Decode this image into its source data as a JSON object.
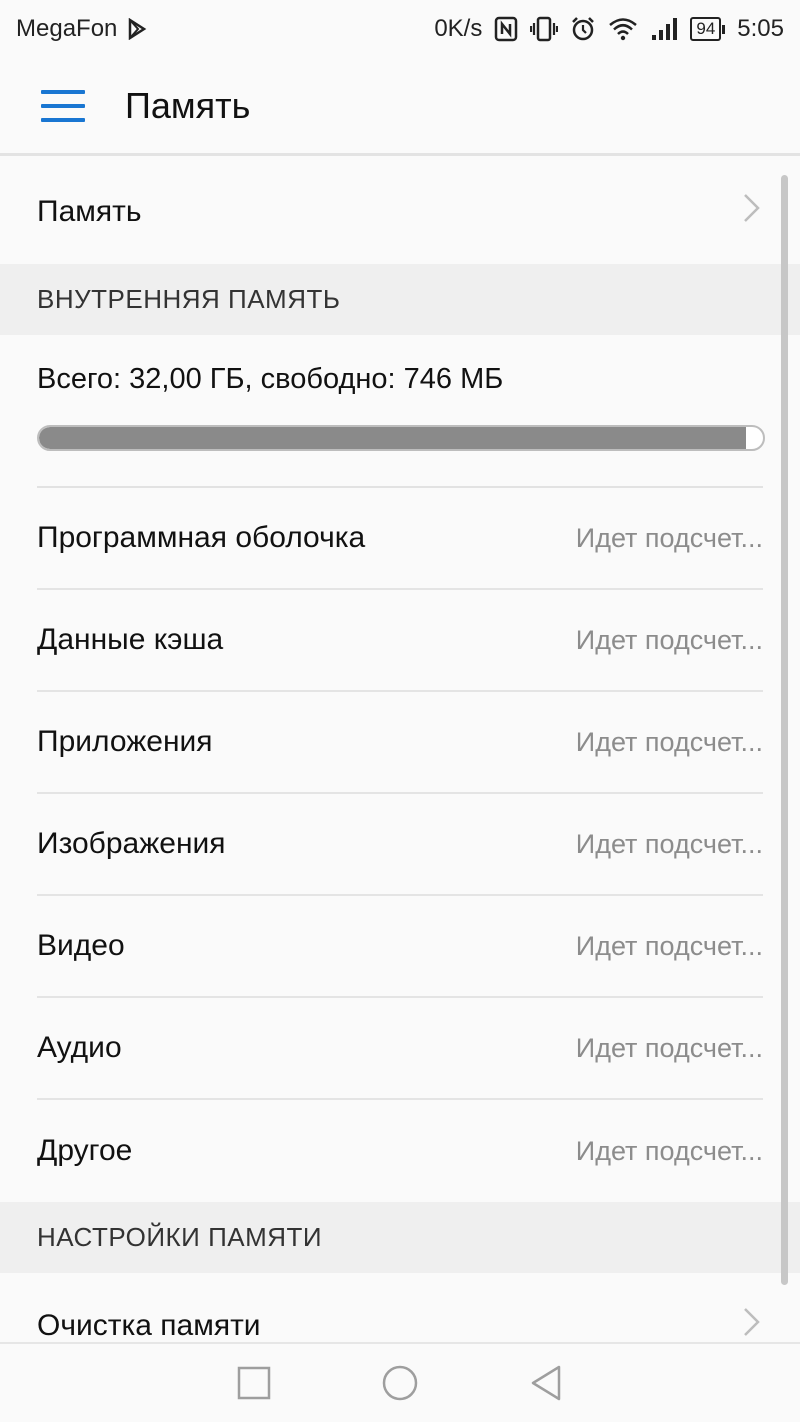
{
  "status_bar": {
    "carrier": "MegaFon",
    "speed": "0K/s",
    "battery_level": "94",
    "time": "5:05"
  },
  "app_bar": {
    "title": "Память"
  },
  "storage_link": {
    "label": "Память"
  },
  "internal_section": {
    "header": "ВНУТРЕННЯЯ ПАМЯТЬ",
    "summary": "Всего: 32,00 ГБ, свободно: 746 МБ",
    "used_fraction": 0.977
  },
  "categories": [
    {
      "label": "Программная оболочка",
      "value": "Идет подсчет..."
    },
    {
      "label": "Данные кэша",
      "value": "Идет подсчет..."
    },
    {
      "label": "Приложения",
      "value": "Идет подсчет..."
    },
    {
      "label": "Изображения",
      "value": "Идет подсчет..."
    },
    {
      "label": "Видео",
      "value": "Идет подсчет..."
    },
    {
      "label": "Аудио",
      "value": "Идет подсчет..."
    },
    {
      "label": "Другое",
      "value": "Идет подсчет..."
    }
  ],
  "settings_section": {
    "header": "НАСТРОЙКИ ПАМЯТИ",
    "items": [
      {
        "label": "Очистка памяти"
      }
    ]
  },
  "colors": {
    "accent": "#1976d2",
    "progress_fill": "#8a8a8a"
  }
}
